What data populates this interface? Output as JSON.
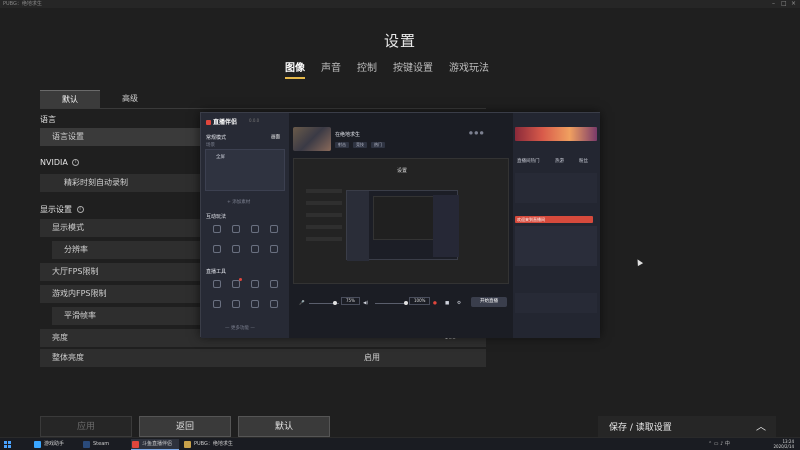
{
  "window": {
    "title": "PUBG：绝地求生"
  },
  "settings": {
    "title": "设置",
    "tabs": [
      "图像",
      "声音",
      "控制",
      "按键设置",
      "游戏玩法"
    ],
    "active_tab": "图像",
    "sub_tabs": [
      "默认",
      "高级"
    ],
    "active_sub_tab": "默认",
    "sections": {
      "language": {
        "title": "语言",
        "value": "语言设置"
      },
      "nvidia": {
        "title": "NVIDIA",
        "value": "精彩时刻自动录制"
      },
      "display": {
        "title": "显示设置",
        "rows": [
          {
            "label": "显示模式"
          },
          {
            "label": "分辨率"
          },
          {
            "label": "大厅FPS限制"
          },
          {
            "label": "游戏内FPS限制"
          },
          {
            "label": "平滑帧率"
          },
          {
            "label": "亮度"
          },
          {
            "label": "整体亮度",
            "value": "启用"
          }
        ]
      }
    },
    "partial_value": "100"
  },
  "buttons": {
    "apply": "应用",
    "back": "返回",
    "default": "默认"
  },
  "save_panel": {
    "label": "保存 / 读取设置",
    "icon": "chevron-up-icon"
  },
  "overlay": {
    "logo": "直播伴侣",
    "version": "0.0.0",
    "mode": "常规模式",
    "scene": "场景",
    "scene_label": "画面",
    "scene_item": "全屏",
    "add_material": "+ 添加素材",
    "interaction": "互动玩法",
    "tools": "直播工具",
    "more": "— 更多功能 —",
    "stream_title": "在绝地求生",
    "tags": [
      "射击",
      "竞技",
      "热门"
    ],
    "preview_title": "设置",
    "mic_pct": "75%",
    "sys_pct": "100%",
    "start_live": "开始直播",
    "right_tabs": [
      "直播间热门",
      "热游",
      "粉丝"
    ],
    "pill": "欢迎来到直播间"
  },
  "taskbar": {
    "items": [
      "游戏助手",
      "Steam",
      "斗鱼直播伴侣",
      "PUBG：绝地求生"
    ],
    "active": "斗鱼直播伴侣",
    "time": "13:24",
    "date": "2020/2/14"
  }
}
